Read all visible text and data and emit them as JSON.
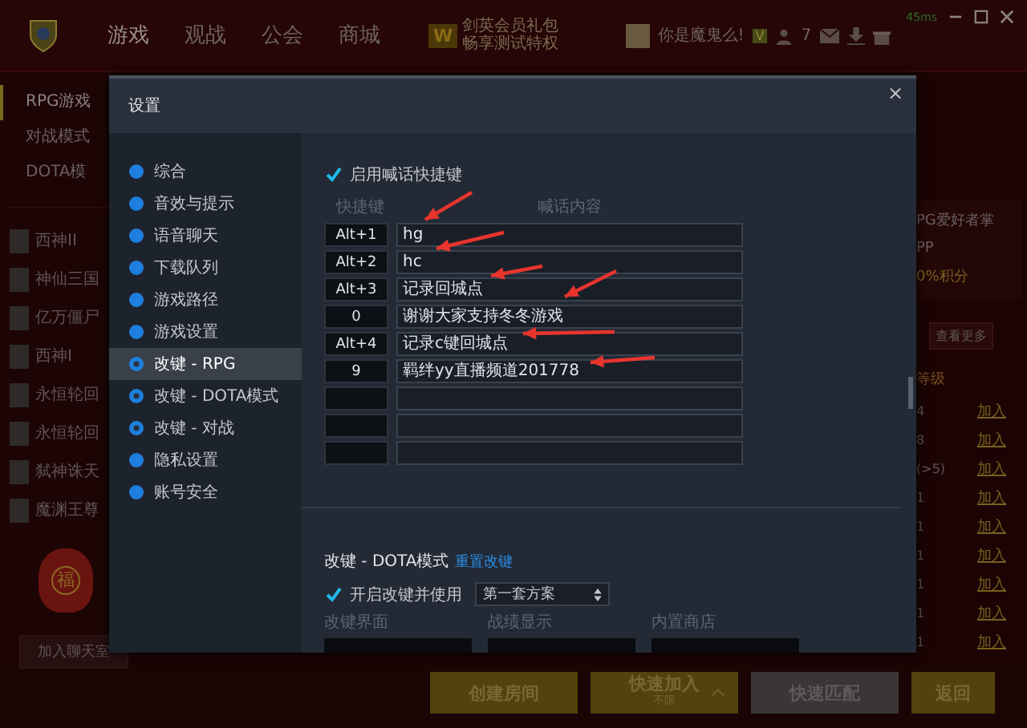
{
  "topbar": {
    "nav": [
      {
        "label": "游戏",
        "selected": true
      },
      {
        "label": "观战",
        "selected": false
      },
      {
        "label": "公会",
        "selected": false
      },
      {
        "label": "商城",
        "selected": false
      }
    ],
    "promo": {
      "badge": "W",
      "title": "剑英会员礼包",
      "subtitle": "畅享测试特权"
    },
    "ping": "45ms",
    "username": "你是魔鬼么!",
    "vip": "V",
    "friends": "7"
  },
  "sidebar": {
    "modes": [
      {
        "label": "RPG游戏",
        "selected": true
      },
      {
        "label": "对战模式",
        "selected": false
      },
      {
        "label": "DOTA模",
        "selected": false
      }
    ],
    "games": [
      "西神II",
      "神仙三国",
      "亿万僵尸",
      "西神I",
      "永恒轮回",
      "永恒轮回",
      "弑神诛天",
      "魔渊王尊"
    ],
    "lucky_bag": "福",
    "chat_button": "加入聊天室"
  },
  "right_panel": {
    "title": "PG爱好者掌",
    "line_1": "PP",
    "line_2": "0%积分",
    "more_button": "查看更多",
    "column_header": "等级",
    "rows": [
      {
        "level": "4",
        "action": "加入"
      },
      {
        "level": "8",
        "action": "加入"
      },
      {
        "level": "(>5)",
        "action": "加入"
      },
      {
        "level": "1",
        "action": "加入"
      },
      {
        "level": "1",
        "action": "加入"
      },
      {
        "level": "1",
        "action": "加入"
      },
      {
        "level": "1",
        "action": "加入"
      },
      {
        "level": "1",
        "action": "加入"
      },
      {
        "level": "1",
        "action": "加入"
      }
    ]
  },
  "bottom_buttons": [
    {
      "label": "创建房间",
      "kind": "gold"
    },
    {
      "label": "快速加入",
      "caption": "不限",
      "kind": "dropdown"
    },
    {
      "label": "快速匹配",
      "kind": "gray"
    },
    {
      "label": "返回",
      "kind": "gold"
    }
  ],
  "dialog": {
    "title": "设置",
    "close": "×",
    "menu": [
      {
        "label": "综合",
        "selected": false
      },
      {
        "label": "音效与提示",
        "selected": false
      },
      {
        "label": "语音聊天",
        "selected": false
      },
      {
        "label": "下载队列",
        "selected": false
      },
      {
        "label": "游戏路径",
        "selected": false
      },
      {
        "label": "游戏设置",
        "selected": false
      },
      {
        "label": "改键 - RPG",
        "selected": true
      },
      {
        "label": "改键 - DOTA模式",
        "selected": false
      },
      {
        "label": "改键 - 对战",
        "selected": false
      },
      {
        "label": "隐私设置",
        "selected": false
      },
      {
        "label": "账号安全",
        "selected": false
      }
    ],
    "shortcuts": {
      "enable_label": "启用喊话快捷键",
      "enabled": true,
      "headers": [
        "快捷键",
        "喊话内容"
      ],
      "rows": [
        {
          "key": "Alt+1",
          "text": "hg"
        },
        {
          "key": "Alt+2",
          "text": "hc"
        },
        {
          "key": "Alt+3",
          "text": "记录回城点"
        },
        {
          "key": "0",
          "text": "谢谢大家支持冬冬游戏"
        },
        {
          "key": "Alt+4",
          "text": "记录c键回城点"
        },
        {
          "key": "9",
          "text": "羁绊yy直播频道201778"
        },
        {},
        {},
        {}
      ]
    },
    "dota": {
      "title": "改键 - DOTA模式",
      "reset_link": "重置改键",
      "enable_label": "开启改键并使用",
      "enabled": true,
      "scheme": "第一套方案",
      "panels": [
        "改键界面",
        "战绩显示",
        "内置商店"
      ]
    }
  }
}
